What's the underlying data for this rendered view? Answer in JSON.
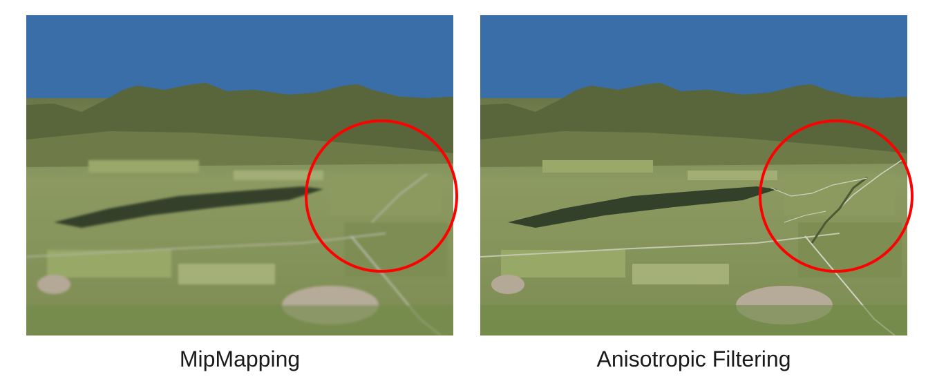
{
  "figures": [
    {
      "caption": "MipMapping",
      "filter": "blurry"
    },
    {
      "caption": "Anisotropic Filtering",
      "filter": "sharp"
    }
  ],
  "colors": {
    "sky": "#3a6ea8",
    "mountain": "#5a6a3a",
    "field": "#8a9a5a",
    "forest": "#3b4a2a",
    "highlight_ring": "#ff0000"
  }
}
